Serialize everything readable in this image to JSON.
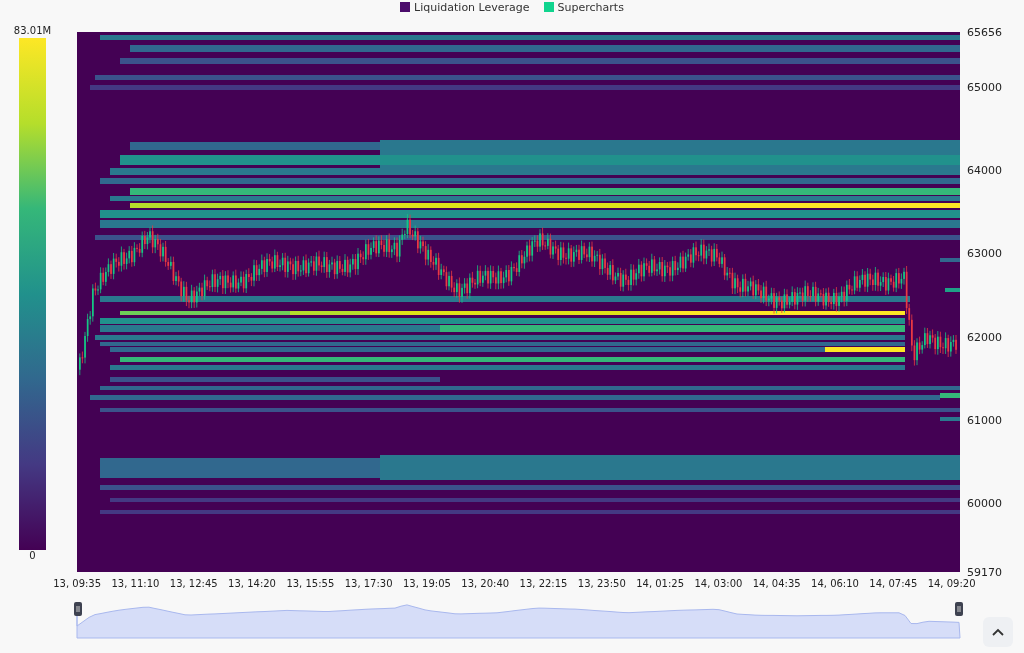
{
  "legend": [
    {
      "label": "Liquidation Leverage",
      "color": "#4b0c6b"
    },
    {
      "label": "Supercharts",
      "color": "#10d48e"
    }
  ],
  "color_scale": {
    "max_label": "83.01M",
    "min_label": "0"
  },
  "y_axis": {
    "labels": [
      "65656",
      "65000",
      "64000",
      "63000",
      "62000",
      "61000",
      "60000",
      "59170"
    ]
  },
  "x_axis": {
    "labels": [
      "13, 09:35",
      "13, 11:10",
      "13, 12:45",
      "13, 14:20",
      "13, 15:55",
      "13, 17:30",
      "13, 19:05",
      "13, 20:40",
      "13, 22:15",
      "13, 23:50",
      "14, 01:25",
      "14, 03:00",
      "14, 04:35",
      "14, 06:10",
      "14, 07:45",
      "14, 09:20"
    ]
  }
}
